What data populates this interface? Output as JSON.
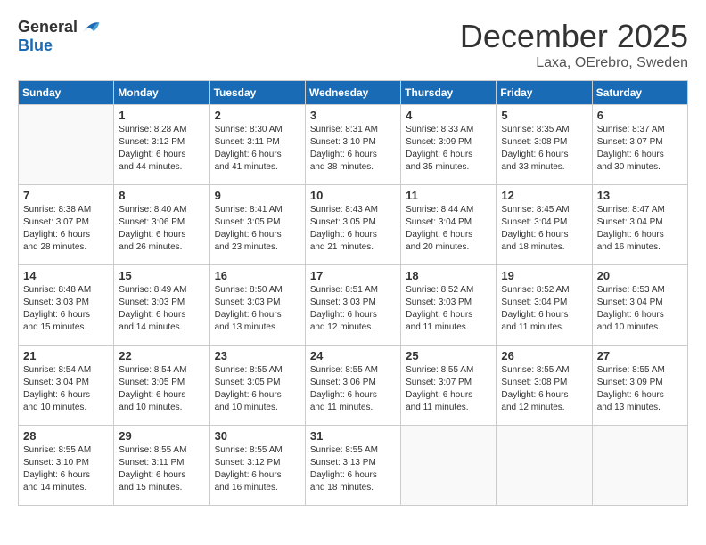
{
  "header": {
    "logo_general": "General",
    "logo_blue": "Blue",
    "month": "December 2025",
    "location": "Laxa, OErebro, Sweden"
  },
  "weekdays": [
    "Sunday",
    "Monday",
    "Tuesday",
    "Wednesday",
    "Thursday",
    "Friday",
    "Saturday"
  ],
  "weeks": [
    [
      {
        "day": "",
        "info": ""
      },
      {
        "day": "1",
        "info": "Sunrise: 8:28 AM\nSunset: 3:12 PM\nDaylight: 6 hours\nand 44 minutes."
      },
      {
        "day": "2",
        "info": "Sunrise: 8:30 AM\nSunset: 3:11 PM\nDaylight: 6 hours\nand 41 minutes."
      },
      {
        "day": "3",
        "info": "Sunrise: 8:31 AM\nSunset: 3:10 PM\nDaylight: 6 hours\nand 38 minutes."
      },
      {
        "day": "4",
        "info": "Sunrise: 8:33 AM\nSunset: 3:09 PM\nDaylight: 6 hours\nand 35 minutes."
      },
      {
        "day": "5",
        "info": "Sunrise: 8:35 AM\nSunset: 3:08 PM\nDaylight: 6 hours\nand 33 minutes."
      },
      {
        "day": "6",
        "info": "Sunrise: 8:37 AM\nSunset: 3:07 PM\nDaylight: 6 hours\nand 30 minutes."
      }
    ],
    [
      {
        "day": "7",
        "info": "Sunrise: 8:38 AM\nSunset: 3:07 PM\nDaylight: 6 hours\nand 28 minutes."
      },
      {
        "day": "8",
        "info": "Sunrise: 8:40 AM\nSunset: 3:06 PM\nDaylight: 6 hours\nand 26 minutes."
      },
      {
        "day": "9",
        "info": "Sunrise: 8:41 AM\nSunset: 3:05 PM\nDaylight: 6 hours\nand 23 minutes."
      },
      {
        "day": "10",
        "info": "Sunrise: 8:43 AM\nSunset: 3:05 PM\nDaylight: 6 hours\nand 21 minutes."
      },
      {
        "day": "11",
        "info": "Sunrise: 8:44 AM\nSunset: 3:04 PM\nDaylight: 6 hours\nand 20 minutes."
      },
      {
        "day": "12",
        "info": "Sunrise: 8:45 AM\nSunset: 3:04 PM\nDaylight: 6 hours\nand 18 minutes."
      },
      {
        "day": "13",
        "info": "Sunrise: 8:47 AM\nSunset: 3:04 PM\nDaylight: 6 hours\nand 16 minutes."
      }
    ],
    [
      {
        "day": "14",
        "info": "Sunrise: 8:48 AM\nSunset: 3:03 PM\nDaylight: 6 hours\nand 15 minutes."
      },
      {
        "day": "15",
        "info": "Sunrise: 8:49 AM\nSunset: 3:03 PM\nDaylight: 6 hours\nand 14 minutes."
      },
      {
        "day": "16",
        "info": "Sunrise: 8:50 AM\nSunset: 3:03 PM\nDaylight: 6 hours\nand 13 minutes."
      },
      {
        "day": "17",
        "info": "Sunrise: 8:51 AM\nSunset: 3:03 PM\nDaylight: 6 hours\nand 12 minutes."
      },
      {
        "day": "18",
        "info": "Sunrise: 8:52 AM\nSunset: 3:03 PM\nDaylight: 6 hours\nand 11 minutes."
      },
      {
        "day": "19",
        "info": "Sunrise: 8:52 AM\nSunset: 3:04 PM\nDaylight: 6 hours\nand 11 minutes."
      },
      {
        "day": "20",
        "info": "Sunrise: 8:53 AM\nSunset: 3:04 PM\nDaylight: 6 hours\nand 10 minutes."
      }
    ],
    [
      {
        "day": "21",
        "info": "Sunrise: 8:54 AM\nSunset: 3:04 PM\nDaylight: 6 hours\nand 10 minutes."
      },
      {
        "day": "22",
        "info": "Sunrise: 8:54 AM\nSunset: 3:05 PM\nDaylight: 6 hours\nand 10 minutes."
      },
      {
        "day": "23",
        "info": "Sunrise: 8:55 AM\nSunset: 3:05 PM\nDaylight: 6 hours\nand 10 minutes."
      },
      {
        "day": "24",
        "info": "Sunrise: 8:55 AM\nSunset: 3:06 PM\nDaylight: 6 hours\nand 11 minutes."
      },
      {
        "day": "25",
        "info": "Sunrise: 8:55 AM\nSunset: 3:07 PM\nDaylight: 6 hours\nand 11 minutes."
      },
      {
        "day": "26",
        "info": "Sunrise: 8:55 AM\nSunset: 3:08 PM\nDaylight: 6 hours\nand 12 minutes."
      },
      {
        "day": "27",
        "info": "Sunrise: 8:55 AM\nSunset: 3:09 PM\nDaylight: 6 hours\nand 13 minutes."
      }
    ],
    [
      {
        "day": "28",
        "info": "Sunrise: 8:55 AM\nSunset: 3:10 PM\nDaylight: 6 hours\nand 14 minutes."
      },
      {
        "day": "29",
        "info": "Sunrise: 8:55 AM\nSunset: 3:11 PM\nDaylight: 6 hours\nand 15 minutes."
      },
      {
        "day": "30",
        "info": "Sunrise: 8:55 AM\nSunset: 3:12 PM\nDaylight: 6 hours\nand 16 minutes."
      },
      {
        "day": "31",
        "info": "Sunrise: 8:55 AM\nSunset: 3:13 PM\nDaylight: 6 hours\nand 18 minutes."
      },
      {
        "day": "",
        "info": ""
      },
      {
        "day": "",
        "info": ""
      },
      {
        "day": "",
        "info": ""
      }
    ]
  ]
}
